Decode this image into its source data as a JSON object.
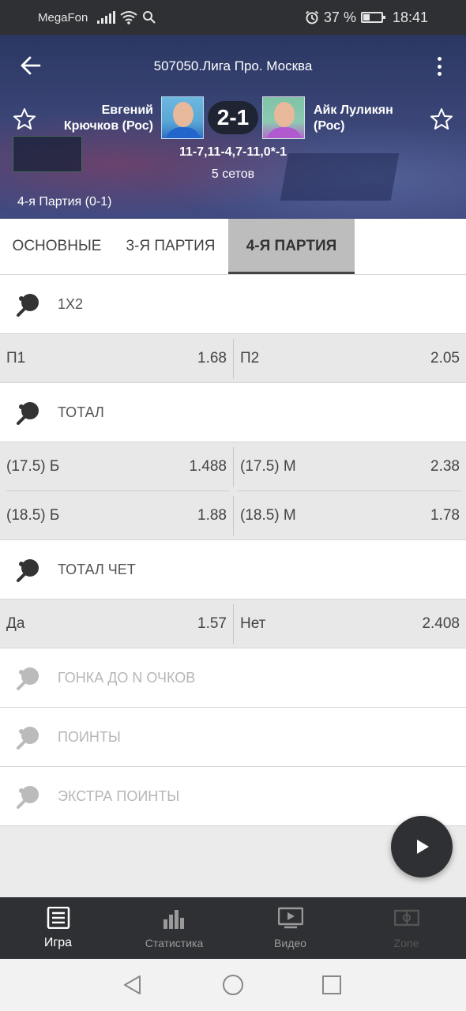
{
  "status_bar": {
    "carrier": "MegaFon",
    "battery": "37 %",
    "time": "18:41",
    "battery_level": 0.37
  },
  "header": {
    "title": "507050.Лига Про. Москва",
    "player1": {
      "name_line1": "Евгений",
      "name_line2": "Крючков (Рос)"
    },
    "player2": {
      "name_line1": "Айк Луликян",
      "name_line2": "(Рос)"
    },
    "score": "2-1",
    "sets_detail": "11-7,11-4,7-11,0*-1",
    "sets_count": "5 сетов",
    "period": "4-я Партия (0-1)"
  },
  "tabs": [
    {
      "label": "ОСНОВНЫЕ"
    },
    {
      "label": "3-Я ПАРТИЯ"
    },
    {
      "label": "4-Я ПАРТИЯ"
    }
  ],
  "markets": {
    "m1x2": {
      "title": "1X2",
      "rows": [
        {
          "l_label": "П1",
          "l_val": "1.68",
          "r_label": "П2",
          "r_val": "2.05"
        }
      ]
    },
    "total": {
      "title": "ТОТАЛ",
      "rows": [
        {
          "l_label": "(17.5) Б",
          "l_val": "1.488",
          "r_label": "(17.5) М",
          "r_val": "2.38"
        },
        {
          "l_label": "(18.5) Б",
          "l_val": "1.88",
          "r_label": "(18.5) М",
          "r_val": "1.78"
        }
      ]
    },
    "total_even": {
      "title": "ТОТАЛ ЧЕТ",
      "rows": [
        {
          "l_label": "Да",
          "l_val": "1.57",
          "r_label": "Нет",
          "r_val": "2.408"
        }
      ]
    },
    "race": {
      "title": "ГОНКА ДО N ОЧКОВ"
    },
    "points": {
      "title": "ПОИНТЫ"
    },
    "extra_points": {
      "title": "ЭКСТРА ПОИНТЫ"
    }
  },
  "bottom_nav": [
    {
      "label": "Игра",
      "icon": "game-list-icon"
    },
    {
      "label": "Статистика",
      "icon": "bar-chart-icon"
    },
    {
      "label": "Видео",
      "icon": "tv-play-icon"
    },
    {
      "label": "Zone",
      "icon": "field-zone-icon"
    }
  ],
  "colors": {
    "dark_bar": "#2f3033",
    "header_bg": "#3a4576",
    "active_tab": "#bdbdbd",
    "odds_bg": "#e8e8e8"
  }
}
